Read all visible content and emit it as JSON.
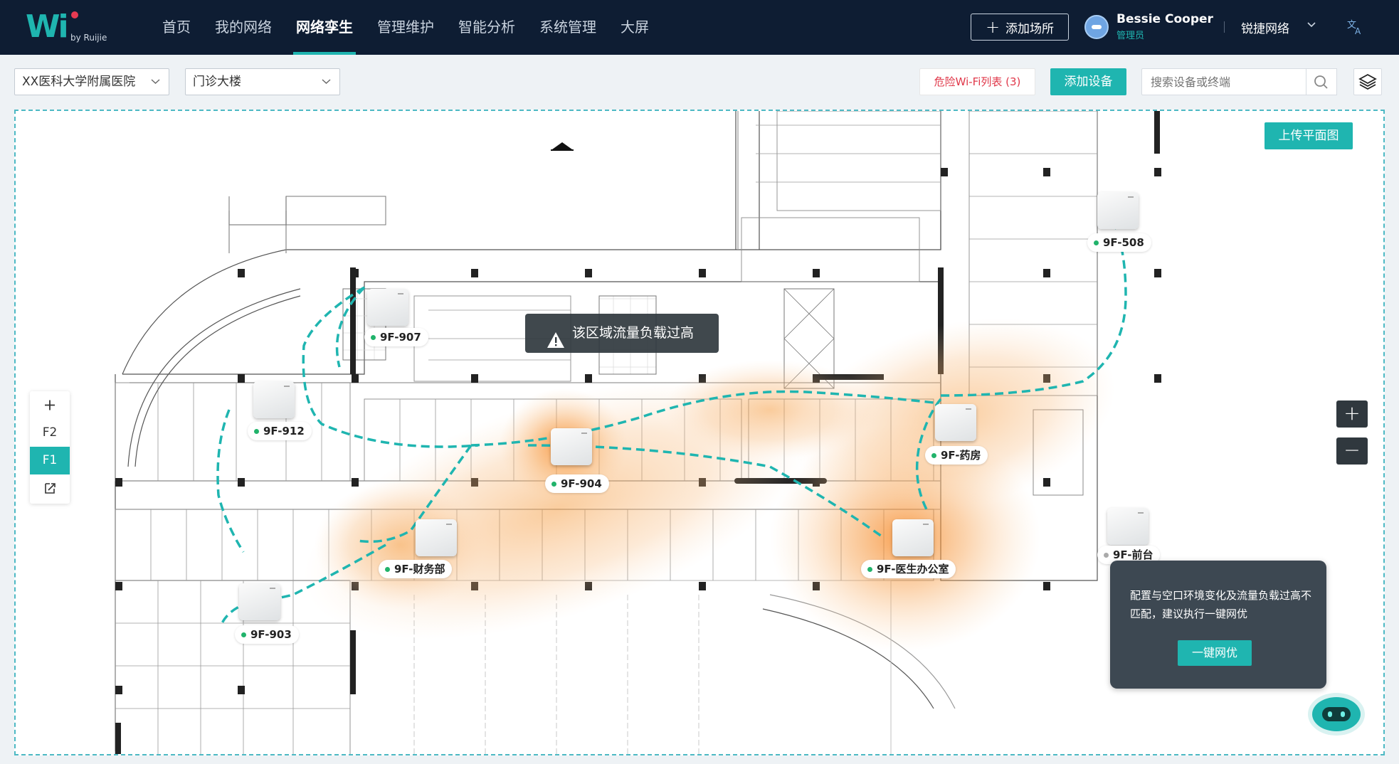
{
  "header": {
    "logo_text": "Wi",
    "logo_sub": "by Ruijie",
    "nav": [
      "首页",
      "我的网络",
      "网络孪生",
      "管理维护",
      "智能分析",
      "系统管理",
      "大屏"
    ],
    "active_nav": "网络孪生",
    "add_site_label": "添加场所",
    "user_name": "Bessie Cooper",
    "user_role": "管理员",
    "org_name": "锐捷网络",
    "language_icon": "translate-icon"
  },
  "toolbar": {
    "site_select": "XX医科大学附属医院",
    "building_select": "门诊大楼",
    "danger_wifi_label": "危险Wi-Fi列表 (3)",
    "add_device_label": "添加设备",
    "search_placeholder": "搜索设备或终端",
    "layers_icon": "layers-icon"
  },
  "map": {
    "upload_label": "上传平面图",
    "alert_text": "该区域流量负载过高",
    "floors": [
      "F2",
      "F1"
    ],
    "active_floor": "F1",
    "zoom_in": "+",
    "zoom_out": "−",
    "heat_color": "#f59a3c",
    "link_color": "#1fb5b0",
    "aps": [
      {
        "name": "9F-907",
        "status": "online"
      },
      {
        "name": "9F-912",
        "status": "online"
      },
      {
        "name": "9F-904",
        "status": "online"
      },
      {
        "name": "9F-财务部",
        "status": "online"
      },
      {
        "name": "9F-903",
        "status": "online"
      },
      {
        "name": "9F-药房",
        "status": "online"
      },
      {
        "name": "9F-医生办公室",
        "status": "online"
      },
      {
        "name": "9F-508",
        "status": "online"
      },
      {
        "name": "9F-前台",
        "status": "offline"
      }
    ]
  },
  "tip": {
    "text": "配置与空口环境变化及流量负载过高不匹配，建议执行一键网优",
    "button_label": "一键网优"
  },
  "colors": {
    "accent": "#1fb5b0",
    "nav_bg": "#0e1d33",
    "danger": "#e0384a",
    "online": "#21b36b"
  }
}
